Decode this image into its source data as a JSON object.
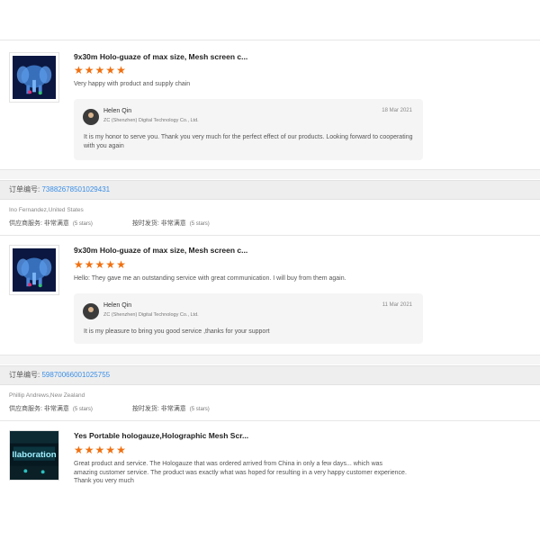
{
  "colors": {
    "star": "#f07010",
    "order_link": "#3a8ee6"
  },
  "reviews": [
    {
      "product_title": "9x30m Holo-guaze of max size, Mesh screen c...",
      "stars": 5,
      "text": "Very happy with product and supply chain",
      "reply": {
        "name": "Helen Qin",
        "company": "ZC (Shenzhen) Digital Technology Co., Ltd.",
        "date": "18 Mar 2021",
        "message": "It is my honor to serve you. Thank you very much for the perfect effect of our products. Looking forward to cooperating with you again"
      }
    },
    {
      "order_label": "订单编号:",
      "order_number": "73882678501029431",
      "buyer": "Ino Fernandez,United States",
      "rating1_label": "供应商服务: 非常满意",
      "rating1_sub": "(5 stars)",
      "rating2_label": "按时发货: 非常满意",
      "rating2_sub": "(5 stars)",
      "product_title": "9x30m Holo-guaze of max size, Mesh screen c...",
      "stars": 5,
      "text": "Hello:  They gave me an outstanding service with great communication.  I will buy from them again.",
      "reply": {
        "name": "Helen Qin",
        "company": "ZC (Shenzhen) Digital Technology Co., Ltd.",
        "date": "11 Mar 2021",
        "message": "It is my pleasure to bring you good service ,thanks for your support"
      }
    },
    {
      "order_label": "订单编号:",
      "order_number": "59870066001025755",
      "buyer": "Phillip Andrews,New Zealand",
      "rating1_label": "供应商服务: 非常满意",
      "rating1_sub": "(5 stars)",
      "rating2_label": "按时发货: 非常满意",
      "rating2_sub": "(5 stars)",
      "product_title": "Yes Portable hologauze,Holographic Mesh Scr...",
      "stars": 5,
      "text": "Great product and service. The Hologauze that was ordered arrived from China in only a few days... which was amazing customer service. The product was exactly what was hoped for resulting in a very happy customer experience. Thank you very much",
      "thumb_text": "llaboration"
    }
  ]
}
